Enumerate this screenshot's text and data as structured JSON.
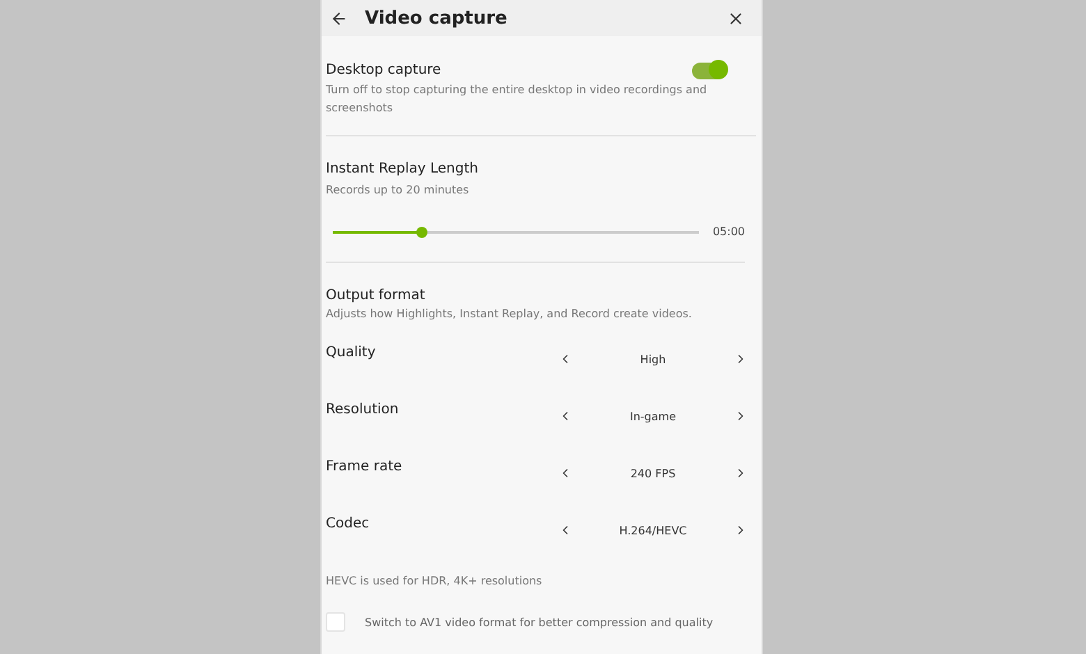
{
  "header": {
    "title": "Video capture"
  },
  "desktop_capture": {
    "title": "Desktop capture",
    "description": "Turn off to stop capturing the entire desktop in video recordings and screenshots",
    "on": true
  },
  "instant_replay": {
    "title": "Instant Replay Length",
    "description": "Records up to 20 minutes",
    "level": 0.245,
    "reading": "05:00"
  },
  "output_format": {
    "title": "Output format",
    "description": "Adjusts how Highlights, Instant Replay, and Record create videos.",
    "settings": [
      {
        "label": "Quality",
        "value": "High"
      },
      {
        "label": "Resolution",
        "value": "In-game"
      },
      {
        "label": "Frame rate",
        "value": "240 FPS"
      },
      {
        "label": "Codec",
        "value": "H.264/HEVC"
      }
    ],
    "note": "HEVC is used for HDR, 4K+ resolutions"
  },
  "av1_option": {
    "label": "Switch to AV1 video format for better compression and quality",
    "checked": false
  }
}
